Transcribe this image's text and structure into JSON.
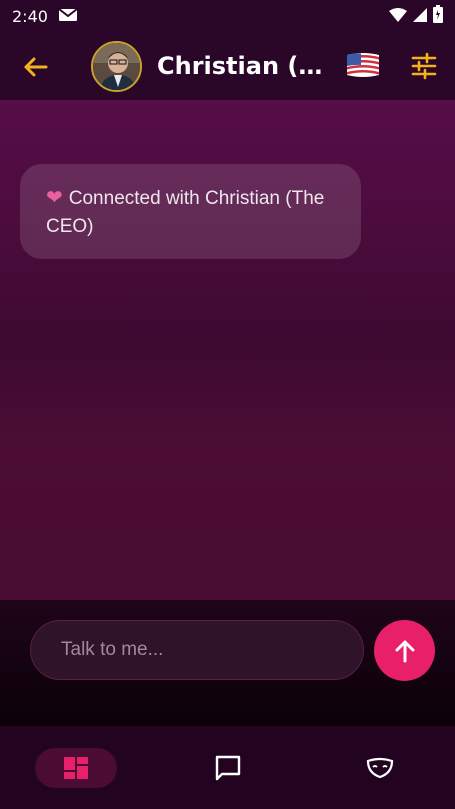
{
  "status_bar": {
    "time": "2:40"
  },
  "header": {
    "title": "Christian (T...",
    "flag_icon": "us-flag-icon",
    "accent_color": "#f2b21b"
  },
  "chat": {
    "system_message": "Connected with Christian (The CEO)"
  },
  "composer": {
    "placeholder": "Talk to me...",
    "send_color": "#e8206a"
  },
  "bottom_nav": {
    "items": [
      {
        "icon": "dashboard-icon",
        "active": true
      },
      {
        "icon": "chat-icon",
        "active": false
      },
      {
        "icon": "mask-icon",
        "active": false
      }
    ],
    "active_color": "#e8206a"
  }
}
